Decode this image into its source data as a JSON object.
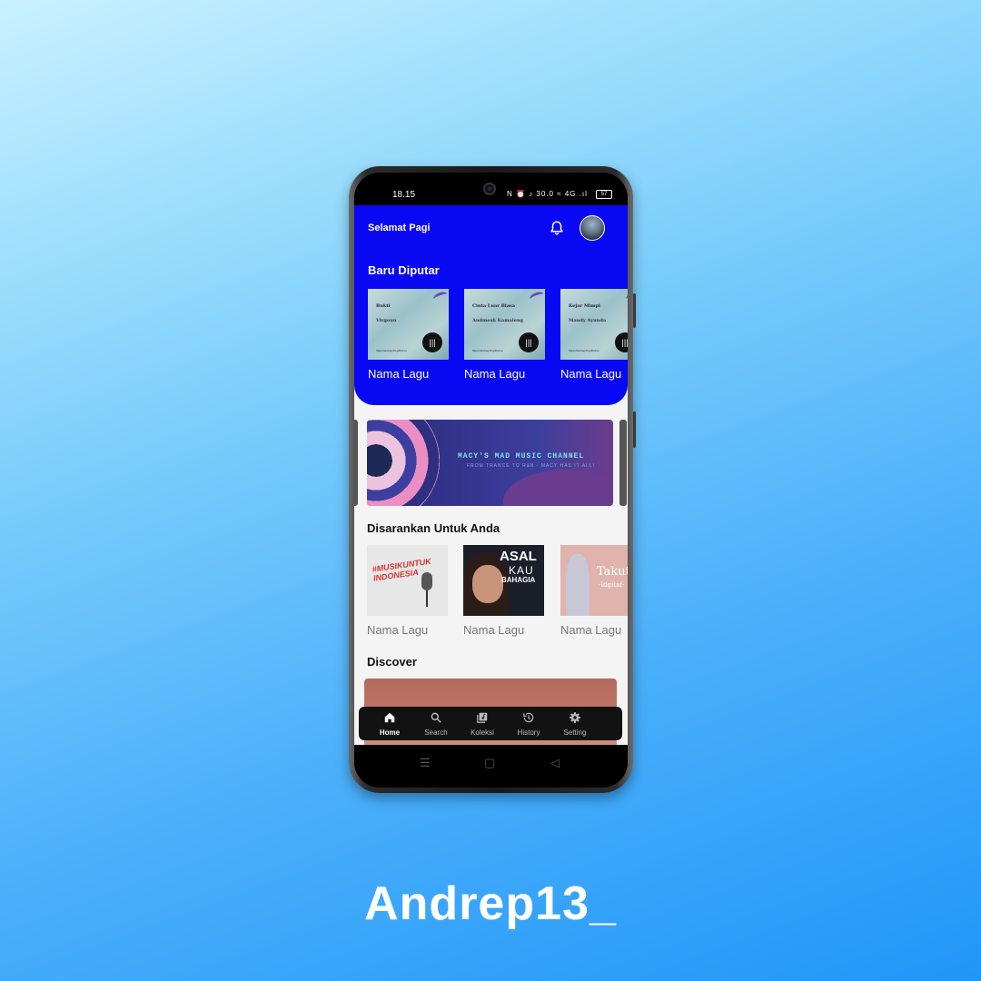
{
  "status_bar": {
    "time": "18.15",
    "icons_text": "N ⏰ ♪ 30.0 ≈ 4G .ıl",
    "battery": "57"
  },
  "header": {
    "greeting": "Selamat Pagi"
  },
  "recent": {
    "title": "Baru Diputar",
    "items": [
      {
        "song": "Bukti",
        "artist": "Virgoun",
        "url": "https://andrep13.github.io",
        "label": "Nama Lagu"
      },
      {
        "song": "Cinta Luar Biasa",
        "artist": "Andmesh Kamaleng",
        "url": "https://andrep13.github.io",
        "label": "Nama Lagu"
      },
      {
        "song": "Kejar Mimpi",
        "artist": "Mandy Ayunda",
        "url": "https://andrep13.github.io",
        "label": "Nama Lagu"
      }
    ]
  },
  "banner": {
    "title": "MACY'S MAD MUSIC CHANNEL",
    "subtitle": "FROM TRANCE TO R&B - MACY HAS IT ALL!"
  },
  "suggested": {
    "title": "Disarankan Untuk Anda",
    "items": [
      {
        "cover_text": "#MUSIKUNTUK INDONESIA",
        "label": "Nama Lagu"
      },
      {
        "cover_line1": "ASAL",
        "cover_line2": "KAU",
        "cover_line3": "BAHAGIA",
        "label": "Nama Lagu"
      },
      {
        "cover_line1": "Takut",
        "cover_line2": "-Idgitaf-",
        "label": "Nama Lagu"
      }
    ]
  },
  "discover": {
    "title": "Discover"
  },
  "bottom_nav": [
    {
      "label": "Home",
      "icon": "home-icon",
      "active": true
    },
    {
      "label": "Search",
      "icon": "search-icon",
      "active": false
    },
    {
      "label": "Koleksi",
      "icon": "library-icon",
      "active": false
    },
    {
      "label": "History",
      "icon": "history-icon",
      "active": false
    },
    {
      "label": "Setting",
      "icon": "gear-icon",
      "active": false
    }
  ],
  "system_nav": {
    "menu": "☰",
    "home": "▢",
    "back": "◁"
  },
  "branding": {
    "text": "Andrep13_"
  },
  "colors": {
    "header_blue": "#0808f2",
    "background": "#f4f4f4",
    "nav_bg": "#121212"
  }
}
